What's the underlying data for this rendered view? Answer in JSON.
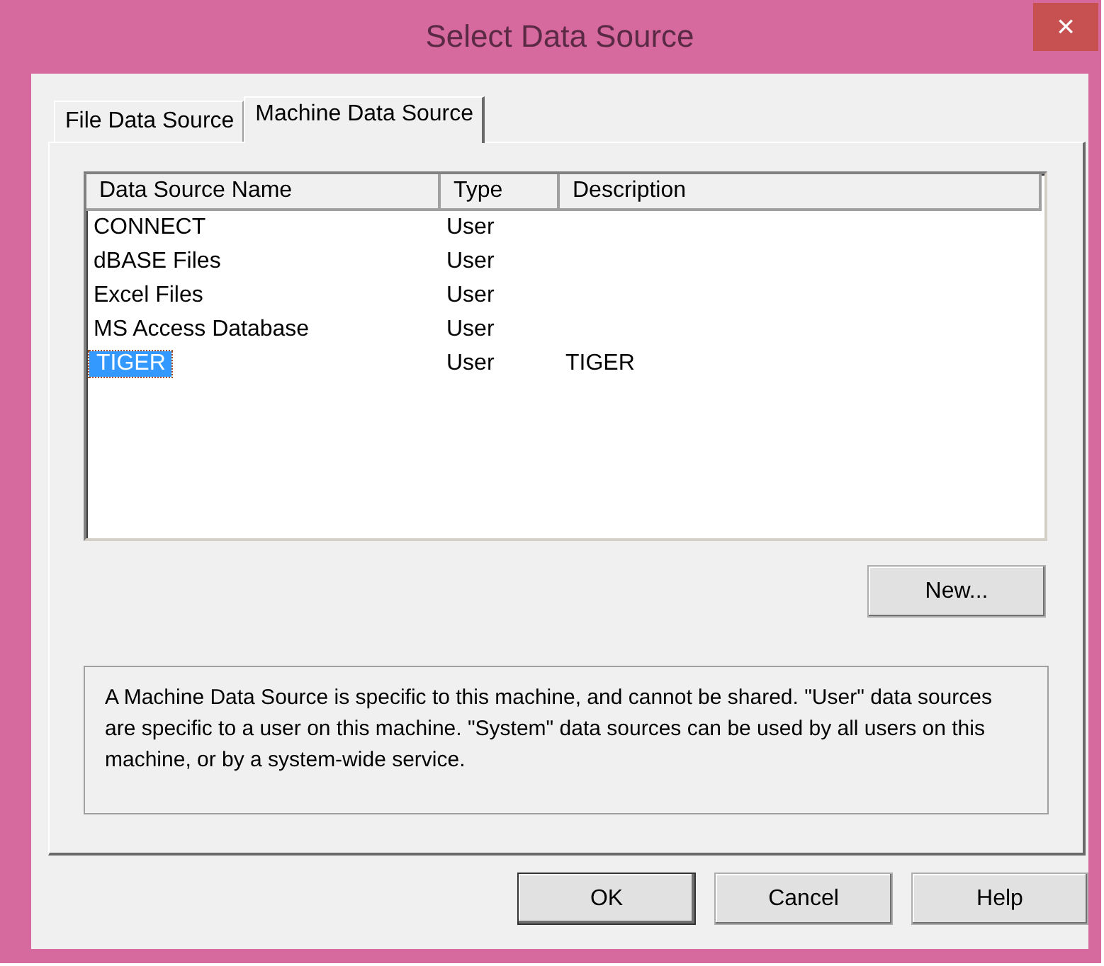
{
  "window": {
    "title": "Select Data Source",
    "close": "×"
  },
  "tabs": [
    {
      "label": "File Data Source",
      "selected": false
    },
    {
      "label": "Machine Data Source",
      "selected": true
    }
  ],
  "table": {
    "columns": [
      "Data Source Name",
      "Type",
      "Description"
    ],
    "rows": [
      {
        "cells": [
          "CONNECT",
          "User",
          ""
        ],
        "selected": false
      },
      {
        "cells": [
          "dBASE Files",
          "User",
          ""
        ],
        "selected": false
      },
      {
        "cells": [
          "Excel Files",
          "User",
          ""
        ],
        "selected": false
      },
      {
        "cells": [
          "MS Access Database",
          "User",
          ""
        ],
        "selected": false
      },
      {
        "cells": [
          "TIGER",
          "User",
          "TIGER"
        ],
        "selected": true
      }
    ]
  },
  "new_button": "New...",
  "info": "A Machine Data Source is specific to this machine, and cannot be shared. \"User\" data sources are specific to a user on this machine.  \"System\" data sources can be used by all users on this machine, or by a system-wide service.",
  "buttons": [
    {
      "label": "OK",
      "default": true
    },
    {
      "label": "Cancel",
      "default": false
    },
    {
      "label": "Help",
      "default": false
    }
  ]
}
